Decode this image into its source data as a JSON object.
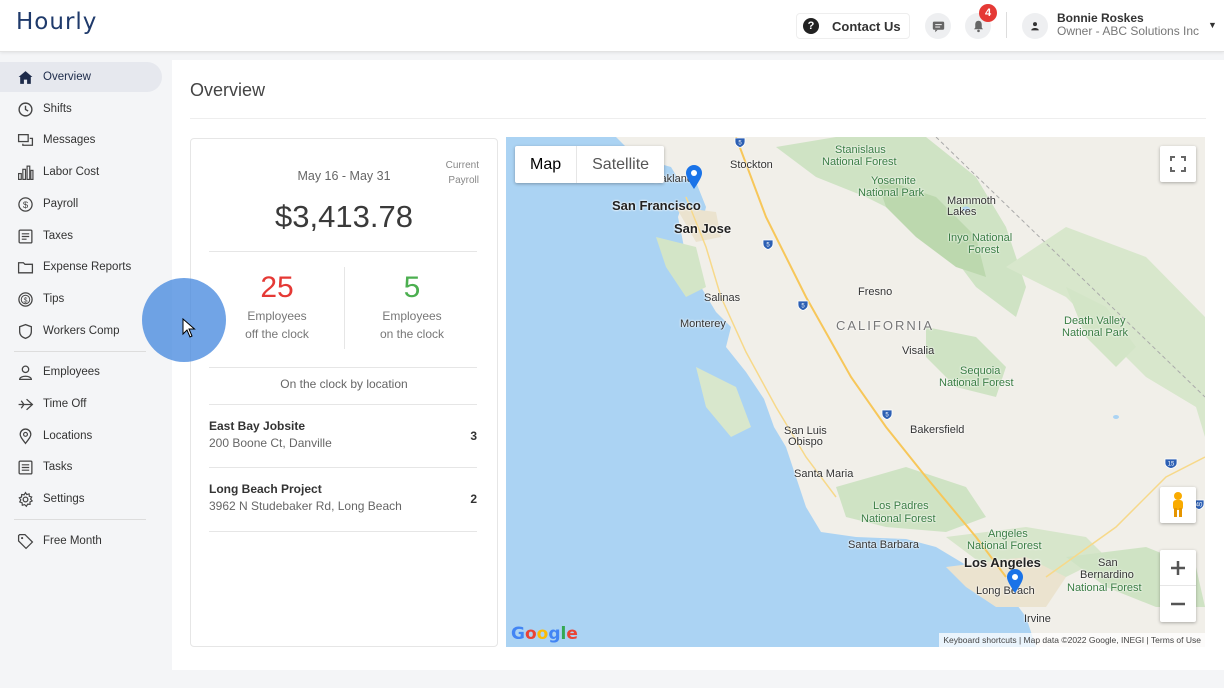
{
  "app": {
    "name": "Hourly"
  },
  "header": {
    "contact_label": "Contact Us",
    "notification_count": "4",
    "user_name": "Bonnie Roskes",
    "user_role": "Owner - ABC Solutions Inc"
  },
  "sidebar": {
    "items": [
      {
        "label": "Overview",
        "icon": "home-icon",
        "active": true
      },
      {
        "label": "Shifts",
        "icon": "clock-icon"
      },
      {
        "label": "Messages",
        "icon": "messages-icon"
      },
      {
        "label": "Labor Cost",
        "icon": "bar-chart-icon"
      },
      {
        "label": "Payroll",
        "icon": "dollar-icon"
      },
      {
        "label": "Taxes",
        "icon": "document-icon"
      },
      {
        "label": "Expense Reports",
        "icon": "folder-icon"
      },
      {
        "label": "Tips",
        "icon": "coin-icon"
      },
      {
        "label": "Workers Comp",
        "icon": "shield-icon"
      },
      {
        "label": "Employees",
        "icon": "person-icon"
      },
      {
        "label": "Time Off",
        "icon": "plane-icon"
      },
      {
        "label": "Locations",
        "icon": "location-pin-icon"
      },
      {
        "label": "Tasks",
        "icon": "list-icon"
      },
      {
        "label": "Settings",
        "icon": "gear-icon"
      },
      {
        "label": "Free Month",
        "icon": "tag-icon"
      }
    ]
  },
  "main": {
    "title": "Overview",
    "payroll": {
      "period": "May 16 - May 31",
      "period_tag_line1": "Current",
      "period_tag_line2": "Payroll",
      "amount": "$3,413.78"
    },
    "stats": {
      "off_clock": {
        "value": "25",
        "label_line1": "Employees",
        "label_line2": "off the clock",
        "color": "#e53935"
      },
      "on_clock": {
        "value": "5",
        "label_line1": "Employees",
        "label_line2": "on the clock",
        "color": "#4caf50"
      }
    },
    "locations_heading": "On the clock by location",
    "locations": [
      {
        "name": "East Bay Jobsite",
        "address": "200 Boone Ct, Danville",
        "count": "3"
      },
      {
        "name": "Long Beach Project",
        "address": "3962 N Studebaker Rd, Long Beach",
        "count": "2"
      }
    ]
  },
  "map": {
    "type_buttons": [
      "Map",
      "Satellite"
    ],
    "selected_type": "Map",
    "labels": {
      "oakland": "Oakland",
      "stockton": "Stockton",
      "san_francisco": "San Francisco",
      "san_jose": "San Jose",
      "stanislaus": "Stanislaus",
      "stanislaus2": "National Forest",
      "yosemite": "Yosemite",
      "yosemite2": "National Park",
      "mammoth": "Mammoth",
      "mammoth2": "Lakes",
      "inyo": "Inyo National",
      "inyo2": "Forest",
      "salinas": "Salinas",
      "monterey": "Monterey",
      "fresno": "Fresno",
      "california": "CALIFORNIA",
      "visalia": "Visalia",
      "death_valley": "Death Valley",
      "death_valley2": "National Park",
      "sequoia": "Sequoia",
      "sequoia2": "National Forest",
      "san_luis": "San Luis",
      "san_luis2": "Obispo",
      "bakersfield": "Bakersfield",
      "santa_maria": "Santa Maria",
      "los_padres": "Los Padres",
      "los_padres2": "National Forest",
      "santa_barbara": "Santa Barbara",
      "angeles": "Angeles",
      "angeles2": "National Forest",
      "los_angeles": "Los Angeles",
      "long_beach": "Long Beach",
      "irvine": "Irvine",
      "san_bernardino": "San",
      "san_bernardino2": "Bernardino",
      "san_bernardino3": "National Forest"
    },
    "highway_shields": [
      "5",
      "5",
      "5",
      "5",
      "15",
      "40"
    ],
    "attribution": "Keyboard shortcuts  |  Map data ©2022 Google, INEGI  |  Terms of Use",
    "google_logo": "Google"
  }
}
